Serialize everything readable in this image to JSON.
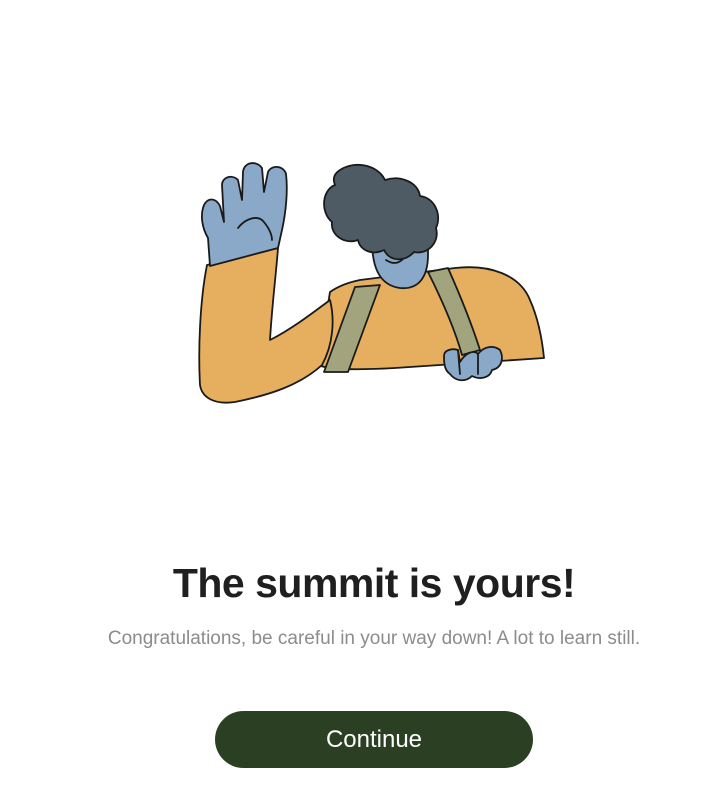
{
  "illustration": {
    "icon": "waving-person-illustration",
    "colors": {
      "skin": "#8aa8c8",
      "sweater": "#e6ae5f",
      "suspenders": "#a2a47d",
      "hair": "#4e5a64",
      "outline": "#1a1a1a"
    }
  },
  "title": "The summit is yours!",
  "subtitle": "Congratulations, be careful in your way down! A lot to learn still.",
  "continue_button": {
    "label": "Continue",
    "color": "#2b4022"
  }
}
